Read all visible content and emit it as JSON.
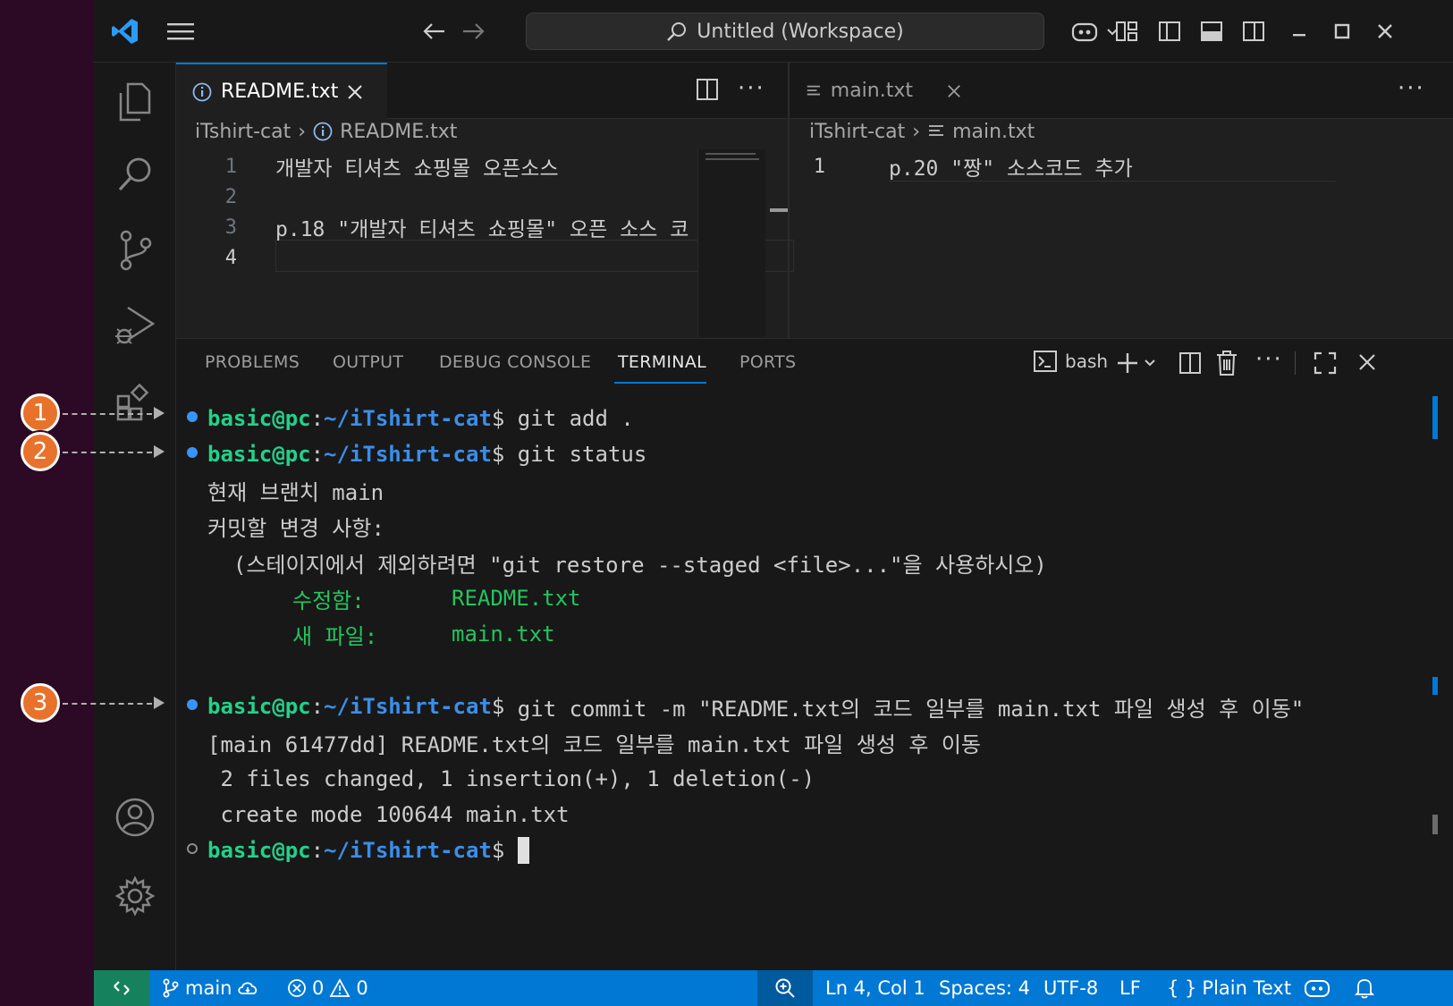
{
  "titlebar": {
    "workspace": "Untitled (Workspace)"
  },
  "editor_left": {
    "tab_label": "README.txt",
    "breadcrumb_folder": "iTshirt-cat",
    "breadcrumb_file": "README.txt",
    "lines": [
      {
        "num": "1",
        "text": "개발자 티셔츠 쇼핑몰 오픈소스"
      },
      {
        "num": "2",
        "text": ""
      },
      {
        "num": "3",
        "text": "p.18 \"개발자 티셔츠 쇼핑몰\" 오픈 소스 코"
      },
      {
        "num": "4",
        "text": ""
      }
    ]
  },
  "editor_right": {
    "tab_label": "main.txt",
    "breadcrumb_folder": "iTshirt-cat",
    "breadcrumb_file": "main.txt",
    "lines": [
      {
        "num": "1",
        "text": "p.20 \"짱\" 소스코드 추가"
      }
    ]
  },
  "panel": {
    "tabs": [
      "PROBLEMS",
      "OUTPUT",
      "DEBUG CONSOLE",
      "TERMINAL",
      "PORTS"
    ],
    "active_tab": "TERMINAL",
    "shell": "bash"
  },
  "terminal": {
    "prompt_user": "basic@pc",
    "prompt_path": "~/iTshirt-cat",
    "prompt_sign": "$",
    "cmd1": " git add .",
    "cmd2": " git status",
    "out_branch": "현재 브랜치 main",
    "out_changes": "커밋할 변경 사항:",
    "out_hint": "  (스테이지에서 제외하려면 \"git restore --staged <file>...\"을 사용하시오)",
    "mod_label": "수정함:",
    "mod_file": "README.txt",
    "new_label": "새 파일:",
    "new_file": "main.txt",
    "cmd3": " git commit -m \"README.txt의 코드 일부를 main.txt 파일 생성 후 이동\"",
    "out_commit": "[main 61477dd] README.txt의 코드 일부를 main.txt 파일 생성 후 이동",
    "out_stats": " 2 files changed, 1 insertion(+), 1 deletion(-)",
    "out_create": " create mode 100644 main.txt"
  },
  "callouts": [
    "1",
    "2",
    "3"
  ],
  "statusbar": {
    "branch": "main",
    "errors": "0",
    "warnings": "0",
    "position": "Ln 4, Col 1",
    "spaces": "Spaces: 4",
    "encoding": "UTF-8",
    "eol": "LF",
    "language": "Plain Text"
  },
  "colors": {
    "accent": "#0078d4",
    "callout": "#e8722b",
    "prompt_user": "#23d18b",
    "prompt_path": "#3b8eea"
  }
}
